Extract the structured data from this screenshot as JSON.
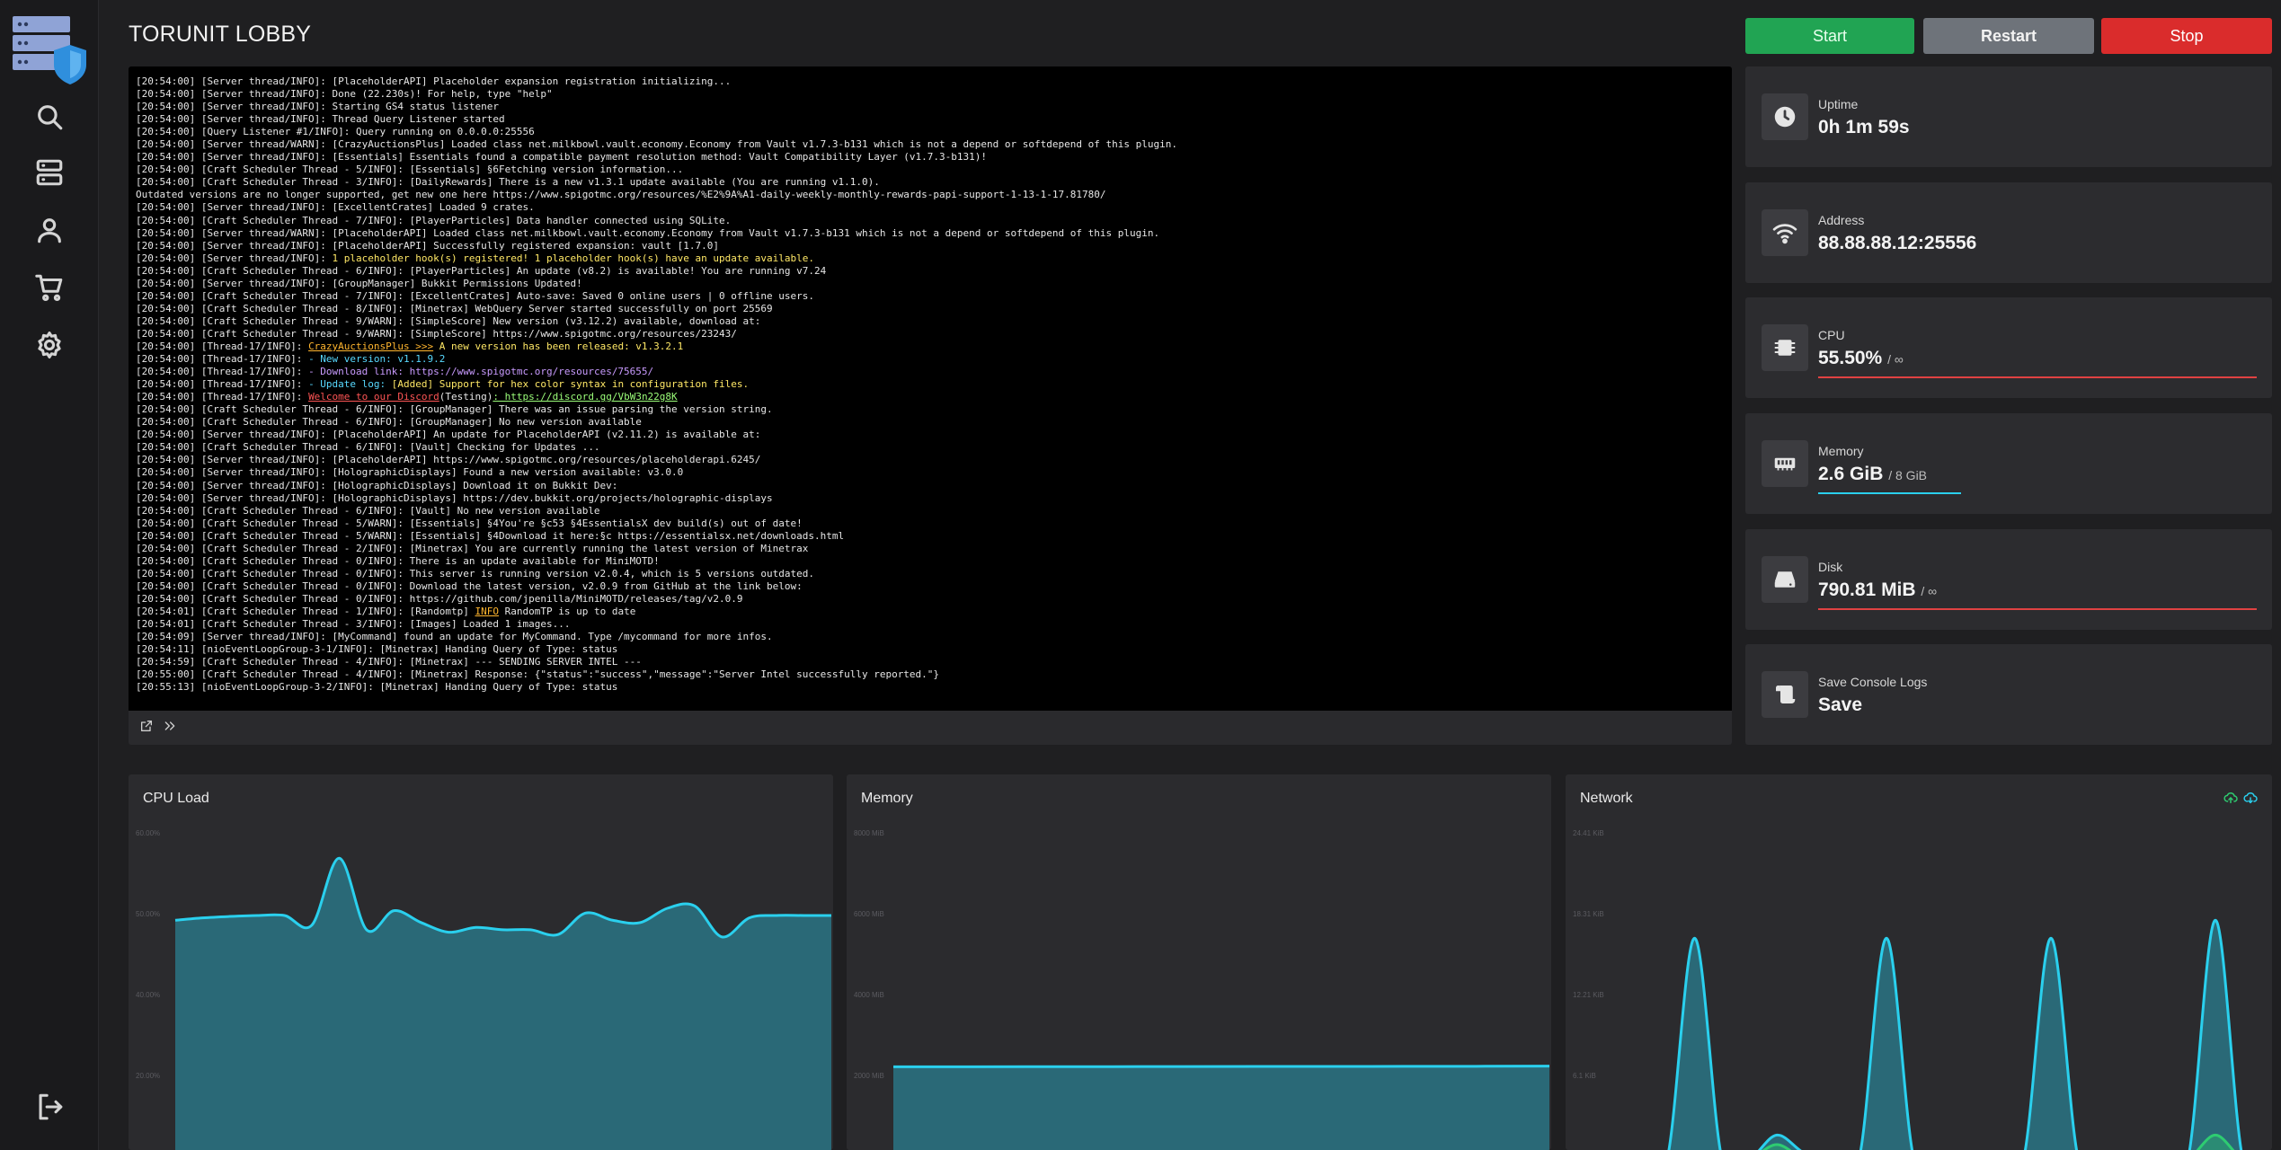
{
  "server": {
    "name": "TORUNIT LOBBY"
  },
  "power": {
    "start": "Start",
    "restart": "Restart",
    "stop": "Stop"
  },
  "colors": {
    "start": "#21a453",
    "restart": "#6e737a",
    "stop": "#da2c2c",
    "accent_cyan": "#2ad0ee",
    "danger": "#e04242",
    "green": "#2ecc71"
  },
  "sidebar": {
    "items": [
      {
        "name": "search",
        "icon": "search-icon"
      },
      {
        "name": "servers",
        "icon": "server-icon"
      },
      {
        "name": "account",
        "icon": "user-icon"
      },
      {
        "name": "store",
        "icon": "cart-icon"
      },
      {
        "name": "settings",
        "icon": "gear-icon"
      },
      {
        "name": "logout",
        "icon": "logout-icon"
      }
    ]
  },
  "console": {
    "lines": [
      [
        {
          "t": "[20:54:00] [Server thread/INFO]: [PlaceholderAPI] Placeholder expansion registration initializing..."
        }
      ],
      [
        {
          "t": "[20:54:00] [Server thread/INFO]: Done (22.230s)! For help, type \"help\""
        }
      ],
      [
        {
          "t": "[20:54:00] [Server thread/INFO]: Starting GS4 status listener"
        }
      ],
      [
        {
          "t": "[20:54:00] [Server thread/INFO]: Thread Query Listener started"
        }
      ],
      [
        {
          "t": "[20:54:00] [Query Listener #1/INFO]: Query running on 0.0.0.0:25556"
        }
      ],
      [
        {
          "t": "[20:54:00] [Server thread/WARN]: [CrazyAuctionsPlus] Loaded class net.milkbowl.vault.economy.Economy from Vault v1.7.3-b131 which is not a depend or softdepend of this plugin."
        }
      ],
      [
        {
          "t": "[20:54:00] [Server thread/INFO]: [Essentials] Essentials found a compatible payment resolution method: Vault Compatibility Layer (v1.7.3-b131)!"
        }
      ],
      [
        {
          "t": "[20:54:00] [Craft Scheduler Thread - 5/INFO]: [Essentials] §6Fetching version information..."
        }
      ],
      [
        {
          "t": "[20:54:00] [Craft Scheduler Thread - 3/INFO]: [DailyRewards] There is a new v1.3.1 update available (You are running v1.1.0)."
        }
      ],
      [
        {
          "t": "Outdated versions are no longer supported, get new one here https://www.spigotmc.org/resources/%E2%9A%A1-daily-weekly-monthly-rewards-papi-support-1-13-1-17.81780/"
        }
      ],
      [
        {
          "t": "[20:54:00] [Server thread/INFO]: [ExcellentCrates] Loaded 9 crates."
        }
      ],
      [
        {
          "t": "[20:54:00] [Craft Scheduler Thread - 7/INFO]: [PlayerParticles] Data handler connected using SQLite."
        }
      ],
      [
        {
          "t": "[20:54:00] [Server thread/WARN]: [PlaceholderAPI] Loaded class net.milkbowl.vault.economy.Economy from Vault v1.7.3-b131 which is not a depend or softdepend of this plugin."
        }
      ],
      [
        {
          "t": "[20:54:00] [Server thread/INFO]: [PlaceholderAPI] Successfully registered expansion: vault [1.7.0]"
        }
      ],
      [
        {
          "t": "[20:54:00] [Server thread/INFO]: "
        },
        {
          "t": "1 placeholder hook(s) registered! 1 placeholder hook(s) have an update available.",
          "c": "yellow"
        }
      ],
      [
        {
          "t": "[20:54:00] [Craft Scheduler Thread - 6/INFO]: [PlayerParticles] An update (v8.2) is available! You are running v7.24"
        }
      ],
      [
        {
          "t": "[20:54:00] [Server thread/INFO]: [GroupManager] Bukkit Permissions Updated!"
        }
      ],
      [
        {
          "t": "[20:54:00] [Craft Scheduler Thread - 7/INFO]: [ExcellentCrates] Auto-save: Saved 0 online users | 0 offline users."
        }
      ],
      [
        {
          "t": "[20:54:00] [Craft Scheduler Thread - 8/INFO]: [Minetrax] WebQuery Server started successfully on port 25569"
        }
      ],
      [
        {
          "t": "[20:54:00] [Craft Scheduler Thread - 9/WARN]: [SimpleScore] New version (v3.12.2) available, download at:"
        }
      ],
      [
        {
          "t": "[20:54:00] [Craft Scheduler Thread - 9/WARN]: [SimpleScore] https://www.spigotmc.org/resources/23243/"
        }
      ],
      [
        {
          "t": "[20:54:00] [Thread-17/INFO]: "
        },
        {
          "t": "CrazyAuctionsPlus >>>",
          "c": "orange"
        },
        {
          "t": " A new version has been released: v1.3.2.1",
          "c": "yellow"
        }
      ],
      [
        {
          "t": "[20:54:00] [Thread-17/INFO]: "
        },
        {
          "t": "- New version: v1.1.9.2",
          "c": "cyan"
        }
      ],
      [
        {
          "t": "[20:54:00] [Thread-17/INFO]: "
        },
        {
          "t": "- Download link: https://www.spigotmc.org/resources/75655/",
          "c": "violet"
        }
      ],
      [
        {
          "t": "[20:54:00] [Thread-17/INFO]: "
        },
        {
          "t": "- Update log: ",
          "c": "cyan"
        },
        {
          "t": "[Added] Support for hex color syntax in configuration files.",
          "c": "yellow"
        }
      ],
      [
        {
          "t": "[20:54:00] [Thread-17/INFO]: "
        },
        {
          "t": "Welcome to our Discord",
          "c": "red"
        },
        {
          "t": "(Testing)"
        },
        {
          "t": ": https://discord.gg/VbW3n22g8K",
          "c": "green"
        }
      ],
      [
        {
          "t": "[20:54:00] [Craft Scheduler Thread - 6/INFO]: [GroupManager] There was an issue parsing the version string."
        }
      ],
      [
        {
          "t": "[20:54:00] [Craft Scheduler Thread - 6/INFO]: [GroupManager] No new version available"
        }
      ],
      [
        {
          "t": "[20:54:00] [Server thread/INFO]: [PlaceholderAPI] An update for PlaceholderAPI (v2.11.2) is available at:"
        }
      ],
      [
        {
          "t": "[20:54:00] [Craft Scheduler Thread - 6/INFO]: [Vault] Checking for Updates ..."
        }
      ],
      [
        {
          "t": "[20:54:00] [Server thread/INFO]: [PlaceholderAPI] https://www.spigotmc.org/resources/placeholderapi.6245/"
        }
      ],
      [
        {
          "t": "[20:54:00] [Server thread/INFO]: [HolographicDisplays] Found a new version available: v3.0.0"
        }
      ],
      [
        {
          "t": "[20:54:00] [Server thread/INFO]: [HolographicDisplays] Download it on Bukkit Dev:"
        }
      ],
      [
        {
          "t": "[20:54:00] [Server thread/INFO]: [HolographicDisplays] https://dev.bukkit.org/projects/holographic-displays"
        }
      ],
      [
        {
          "t": "[20:54:00] [Craft Scheduler Thread - 6/INFO]: [Vault] No new version available"
        }
      ],
      [
        {
          "t": "[20:54:00] [Craft Scheduler Thread - 5/WARN]: [Essentials] §4You're §c53 §4EssentialsX dev build(s) out of date!"
        }
      ],
      [
        {
          "t": "[20:54:00] [Craft Scheduler Thread - 5/WARN]: [Essentials] §4Download it here:§c https://essentialsx.net/downloads.html"
        }
      ],
      [
        {
          "t": "[20:54:00] [Craft Scheduler Thread - 2/INFO]: [Minetrax] You are currently running the latest version of Minetrax"
        }
      ],
      [
        {
          "t": "[20:54:00] [Craft Scheduler Thread - 0/INFO]: There is an update available for MiniMOTD!"
        }
      ],
      [
        {
          "t": "[20:54:00] [Craft Scheduler Thread - 0/INFO]: This server is running version v2.0.4, which is 5 versions outdated."
        }
      ],
      [
        {
          "t": "[20:54:00] [Craft Scheduler Thread - 0/INFO]: Download the latest version, v2.0.9 from GitHub at the link below:"
        }
      ],
      [
        {
          "t": "[20:54:00] [Craft Scheduler Thread - 0/INFO]: https://github.com/jpenilla/MiniMOTD/releases/tag/v2.0.9"
        }
      ],
      [
        {
          "t": "[20:54:01] [Craft Scheduler Thread - 1/INFO]: [Randomtp] "
        },
        {
          "t": "INFO",
          "c": "orange"
        },
        {
          "t": " RandomTP is up to date"
        }
      ],
      [
        {
          "t": "[20:54:01] [Craft Scheduler Thread - 3/INFO]: [Images] Loaded 1 images..."
        }
      ],
      [
        {
          "t": "[20:54:09] [Server thread/INFO]: [MyCommand] found an update for MyCommand. Type /mycommand for more infos."
        }
      ],
      [
        {
          "t": "[20:54:11] [nioEventLoopGroup-3-1/INFO]: [Minetrax] Handing Query of Type: status"
        }
      ],
      [
        {
          "t": "[20:54:59] [Craft Scheduler Thread - 4/INFO]: [Minetrax] --- SENDING SERVER INTEL ---"
        }
      ],
      [
        {
          "t": "[20:55:00] [Craft Scheduler Thread - 4/INFO]: [Minetrax] Response: {\"status\":\"success\",\"message\":\"Server Intel successfully reported.\"}"
        }
      ],
      [
        {
          "t": "[20:55:13] [nioEventLoopGroup-3-2/INFO]: [Minetrax] Handing Query of Type: status"
        }
      ]
    ]
  },
  "stats": {
    "uptime": {
      "label": "Uptime",
      "value": "0h 1m 59s"
    },
    "address": {
      "label": "Address",
      "value": "88.88.88.12:25556"
    },
    "cpu": {
      "label": "CPU",
      "value": "55.50%",
      "limit": "/ ∞",
      "bar_fraction": 1.0
    },
    "memory": {
      "label": "Memory",
      "value": "2.6 GiB",
      "limit": "/ 8 GiB",
      "bar_fraction": 0.325
    },
    "disk": {
      "label": "Disk",
      "value": "790.81 MiB",
      "limit": "/ ∞",
      "bar_fraction": 1.0
    },
    "save_logs": {
      "label": "Save Console Logs",
      "value": "Save"
    }
  },
  "graphs": {
    "cpu": {
      "title": "CPU Load"
    },
    "memory": {
      "title": "Memory"
    },
    "network": {
      "title": "Network"
    }
  },
  "chart_data": [
    {
      "type": "area",
      "title": "CPU Load",
      "y_ticks": [
        "60.00%",
        "50.00%",
        "40.00%",
        "20.00%"
      ],
      "ylim": [
        0,
        70
      ],
      "values": [
        50,
        50.5,
        50.8,
        51,
        51,
        49,
        63,
        48,
        52,
        49.5,
        47.5,
        48.5,
        48,
        48,
        47,
        51.5,
        50,
        49.5,
        52.5,
        53,
        46.5,
        50.5,
        51,
        51,
        51
      ]
    },
    {
      "type": "area",
      "title": "Memory",
      "y_ticks": [
        "8000 MiB",
        "6000 MiB",
        "4000 MiB",
        "2000 MiB"
      ],
      "ylim": [
        0,
        9500
      ],
      "values": [
        2620,
        2620,
        2625,
        2625,
        2628,
        2630,
        2630,
        2632,
        2635,
        2640
      ]
    },
    {
      "type": "area",
      "title": "Network",
      "y_ticks": [
        "24.41 KiB",
        "18.31 KiB",
        "12.21 KiB",
        "6.1 KiB"
      ],
      "ylim": [
        0,
        28
      ],
      "series": [
        {
          "color": "#2ad0ee",
          "values": [
            0,
            0,
            0,
            18.5,
            0,
            0,
            2,
            0.5,
            0,
            0,
            18.5,
            0,
            0,
            0,
            0,
            0,
            18.5,
            0,
            0,
            0,
            0,
            0,
            20,
            0,
            0
          ]
        },
        {
          "color": "#2ecc71",
          "values": [
            0,
            0,
            0,
            0,
            0,
            0,
            1.2,
            0,
            0,
            0,
            0,
            0,
            0,
            0,
            0,
            0,
            0,
            0,
            0,
            0,
            0,
            0,
            2,
            0,
            0
          ]
        }
      ]
    }
  ]
}
